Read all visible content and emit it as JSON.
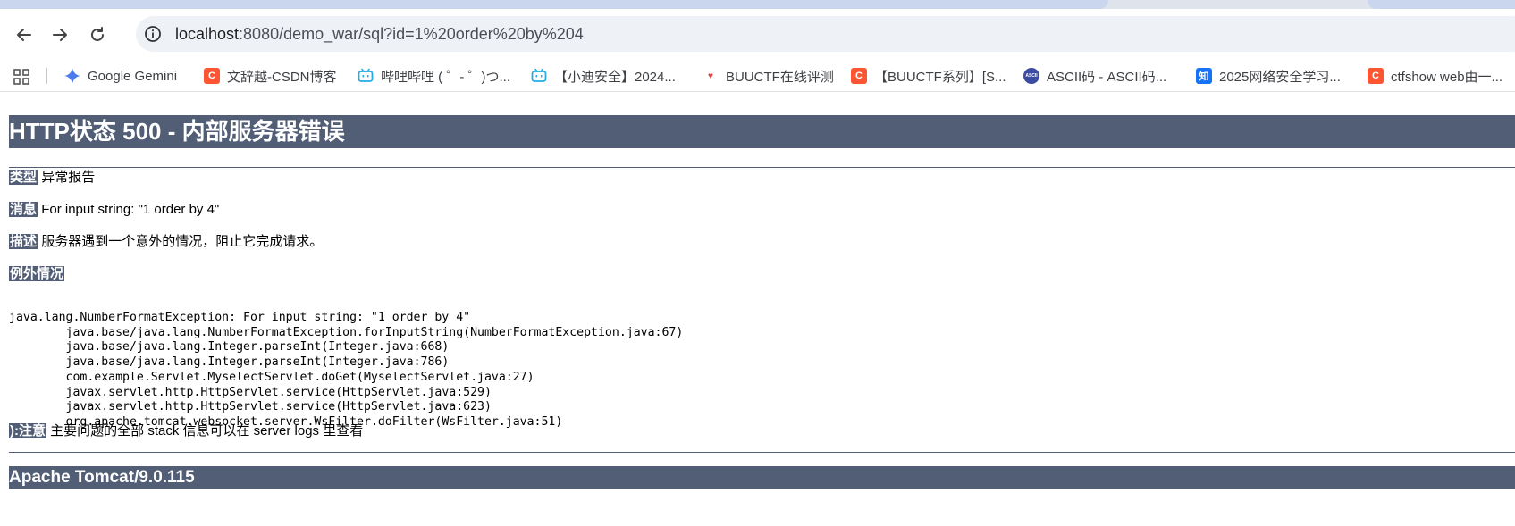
{
  "browser": {
    "url_host": "localhost",
    "url_path": ":8080/demo_war/sql?id=1%20order%20by%204",
    "bookmarks": [
      {
        "label": "Google Gemini",
        "icon": "gemini-icon",
        "color": "#4b7bec"
      },
      {
        "label": "文辞越-CSDN博客",
        "icon": "csdn-icon",
        "color": "#fc5531"
      },
      {
        "label": "哔哩哔哩 ( ゜- ゜)つ...",
        "icon": "bilibili-icon",
        "color": "#23ade5"
      },
      {
        "label": "【小迪安全】2024...",
        "icon": "bilibili-icon",
        "color": "#23ade5"
      },
      {
        "label": "BUUCTF在线评测",
        "icon": "buuctf-icon",
        "color": "#e04040"
      },
      {
        "label": "【BUUCTF系列】[S...",
        "icon": "csdn-icon",
        "color": "#fc5531"
      },
      {
        "label": "ASCII码 - ASCII码...",
        "icon": "ascii-icon",
        "color": "#3b4ba0"
      },
      {
        "label": "2025网络安全学习...",
        "icon": "zhihu-icon",
        "color": "#1772f6"
      },
      {
        "label": "ctfshow web由一...",
        "icon": "csdn-icon",
        "color": "#fc5531"
      }
    ]
  },
  "error": {
    "title": "HTTP状态 500 - 内部服务器错误",
    "type_label": "类型",
    "type_value": "异常报告",
    "message_label": "消息",
    "message_value": "For input string: \"1 order by 4\"",
    "description_label": "描述",
    "description_value": "服务器遇到一个意外的情况，阻止它完成请求。",
    "exception_label": "例外情况",
    "stack_lines": [
      "java.lang.NumberFormatException: For input string: \"1 order by 4\"",
      "\tjava.base/java.lang.NumberFormatException.forInputString(NumberFormatException.java:67)",
      "\tjava.base/java.lang.Integer.parseInt(Integer.java:668)",
      "\tjava.base/java.lang.Integer.parseInt(Integer.java:786)",
      "\tcom.example.Servlet.MyselectServlet.doGet(MyselectServlet.java:27)",
      "\tjavax.servlet.http.HttpServlet.service(HttpServlet.java:529)",
      "\tjavax.servlet.http.HttpServlet.service(HttpServlet.java:623)",
      "\torg.apache.tomcat.websocket.server.WsFilter.doFilter(WsFilter.java:51)"
    ],
    "note_label": "):注意",
    "note_value": "主要问题的全部 stack 信息可以在 server logs 里查看",
    "server_version": "Apache Tomcat/9.0.115"
  },
  "colors": {
    "tomcat_header": "#525d76"
  }
}
